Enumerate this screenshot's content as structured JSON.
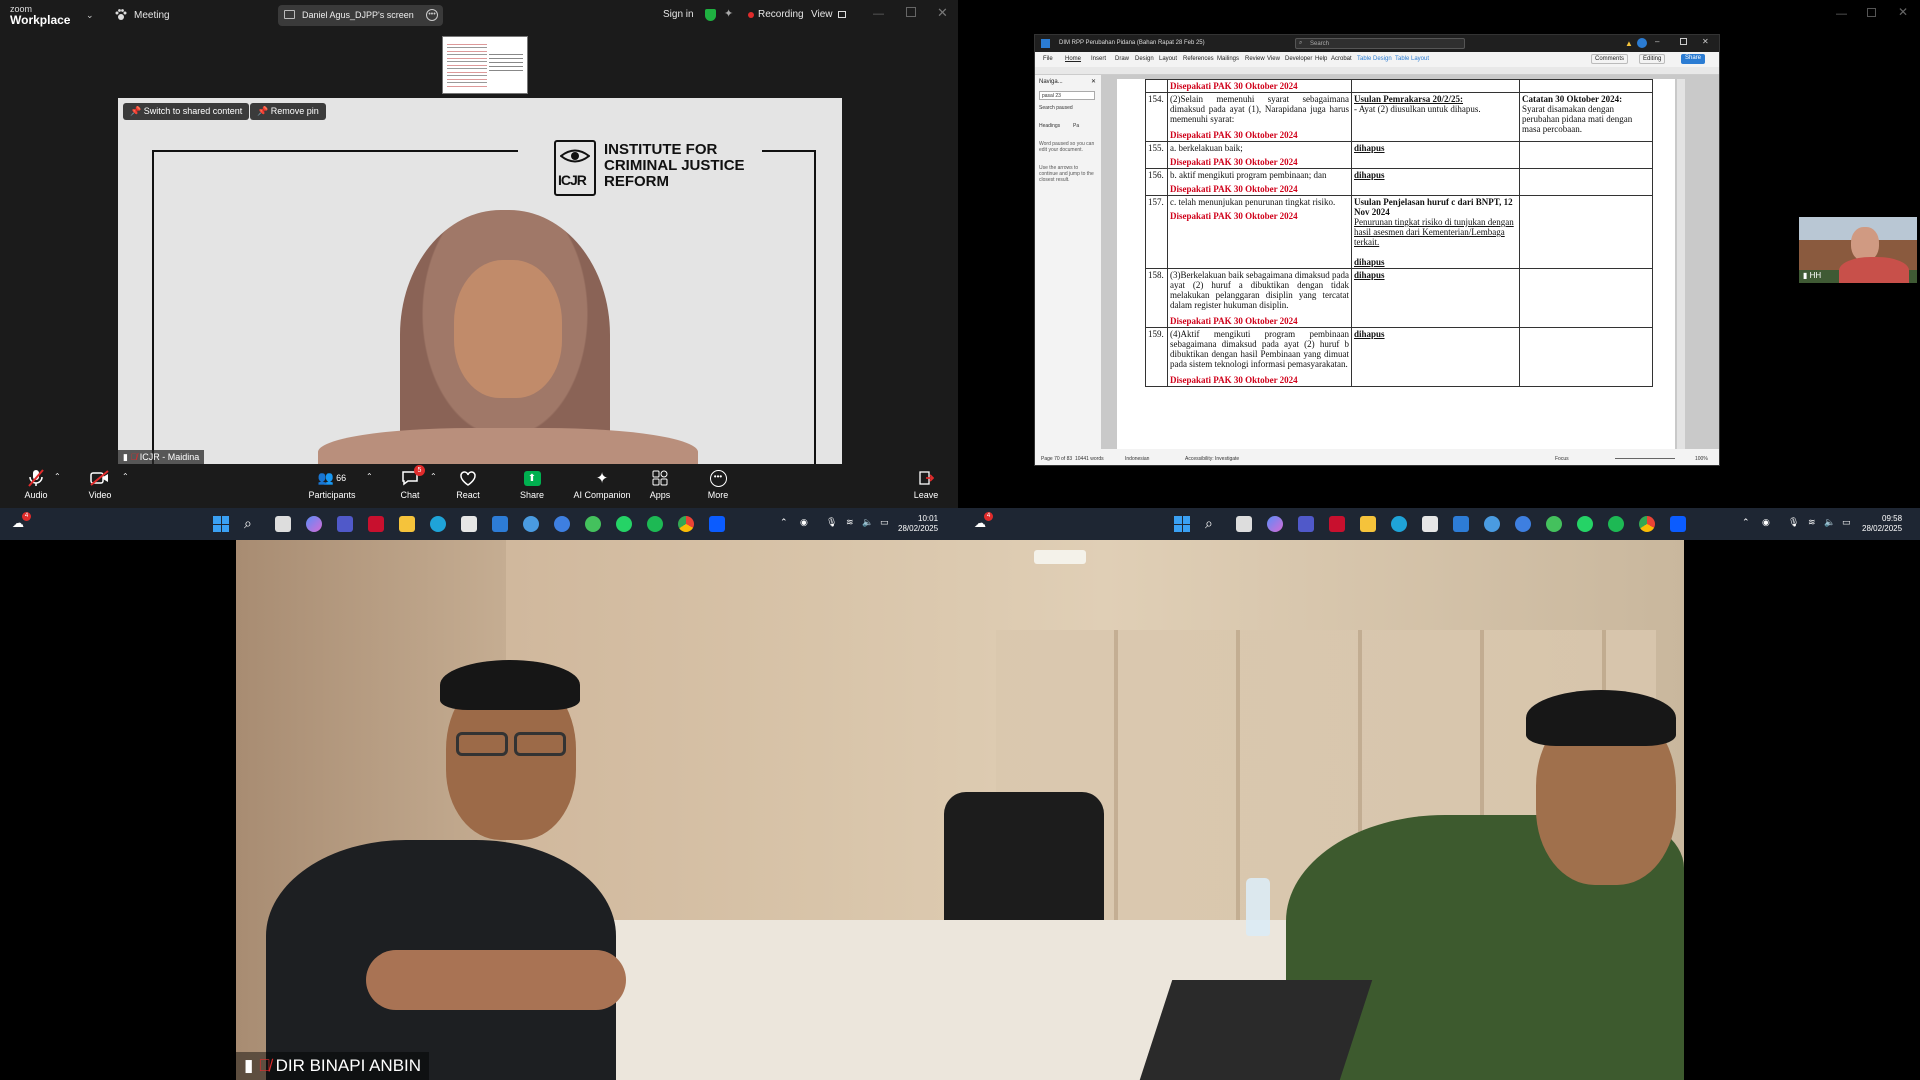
{
  "left_window": {
    "app_brand_small": "zoom",
    "app_brand": "Workplace",
    "meeting_label": "Meeting",
    "share_indicator": "Daniel Agus_DJPP's screen",
    "sign_in": "Sign in",
    "recording": "Recording",
    "view": "View",
    "pin_buttons": {
      "switch": "Switch to shared content",
      "remove": "Remove pin"
    },
    "logo_text": {
      "line1": "INSTITUTE FOR",
      "line2": "CRIMINAL JUSTICE",
      "line3": "REFORM",
      "badge": "ICJR"
    },
    "participant_name": "ICJR - Maidina",
    "toolbar": {
      "audio": "Audio",
      "video": "Video",
      "participants": "Participants",
      "participants_count": "66",
      "chat": "Chat",
      "chat_badge": "5",
      "react": "React",
      "share": "Share",
      "ai": "AI Companion",
      "apps": "Apps",
      "more": "More",
      "leave": "Leave"
    },
    "taskbar": {
      "time": "10:01",
      "date": "28/02/2025",
      "weather_badge": "4"
    }
  },
  "right_window": {
    "word_title": "DIM RPP Perubahan Pidana (Bahan Rapat 28 Feb 25)",
    "search_placeholder": "Search",
    "menu": [
      "File",
      "Home",
      "Insert",
      "Draw",
      "Design",
      "Layout",
      "References",
      "Mailings",
      "Review",
      "View",
      "Developer",
      "Help",
      "Acrobat",
      "Table Design",
      "Table Layout"
    ],
    "comments": "Comments",
    "editing": "Editing",
    "share": "Share",
    "nav": {
      "title": "Naviga...",
      "search_value": "pasal 23",
      "search_paused": "Search paused",
      "headings": "Headings",
      "pages": "Pa",
      "note1": "Word paused so you can edit your document.",
      "note2": "Use the arrows to continue and jump to the closest result."
    },
    "doc": {
      "agreed": "Disepakati PAK 30 Oktober 2024",
      "rows": [
        {
          "num": "154.",
          "text": "(2)Selain memenuhi syarat sebagaimana dimaksud pada ayat (1), Narapidana juga harus memenuhi syarat:",
          "c2_title": "Usulan Pemrakarsa 20/2/25:",
          "c2_text": "- Ayat (2) diusulkan untuk dihapus.",
          "c3_title": "Catatan 30 Oktober 2024:",
          "c3_text": "Syarat disamakan dengan perubahan pidana mati dengan masa percobaan."
        },
        {
          "num": "155.",
          "text": "a. berkelakuan baik;",
          "c2_title": "dihapus"
        },
        {
          "num": "156.",
          "text": "b. aktif mengikuti program pembinaan; dan",
          "c2_title": "dihapus"
        },
        {
          "num": "157.",
          "text": "c. telah menunjukan penurunan tingkat risiko.",
          "c2_title": "Usulan Penjelasan huruf c dari BNPT, 12 Nov 2024",
          "c2_text": "Penurunan tingkat risiko di tunjukan dengan hasil asesmen dari Kementerian/Lembaga terkait.",
          "c2_extra": "dihapus"
        },
        {
          "num": "158.",
          "text": "(3)Berkelakuan baik sebagaimana dimaksud pada ayat (2) huruf a dibuktikan dengan tidak melakukan pelanggaran disiplin yang tercatat dalam register hukuman disiplin.",
          "c2_title": "dihapus"
        },
        {
          "num": "159.",
          "text": "(4)Aktif mengikuti program pembinaan sebagaimana dimaksud pada ayat (2) huruf b dibuktikan dengan hasil Pembinaan yang dimuat pada sistem teknologi informasi pemasyarakatan.",
          "c2_title": "dihapus"
        }
      ]
    },
    "status": {
      "page": "Page 70 of 83",
      "words": "10441 words",
      "language": "Indonesian",
      "accessibility": "Accessibility: Investigate",
      "focus": "Focus",
      "zoom": "100%"
    },
    "hh_label": "HH",
    "taskbar": {
      "time": "09:58",
      "date": "28/02/2025",
      "weather_badge": "4"
    }
  },
  "bottom_video": {
    "participant_name": "DIR BINAPI ANBIN"
  },
  "colors": {
    "accent_red": "#e02b2b",
    "zoom_blue": "#0b5cff",
    "share_green": "#00b050",
    "doc_red": "#d0021b"
  }
}
